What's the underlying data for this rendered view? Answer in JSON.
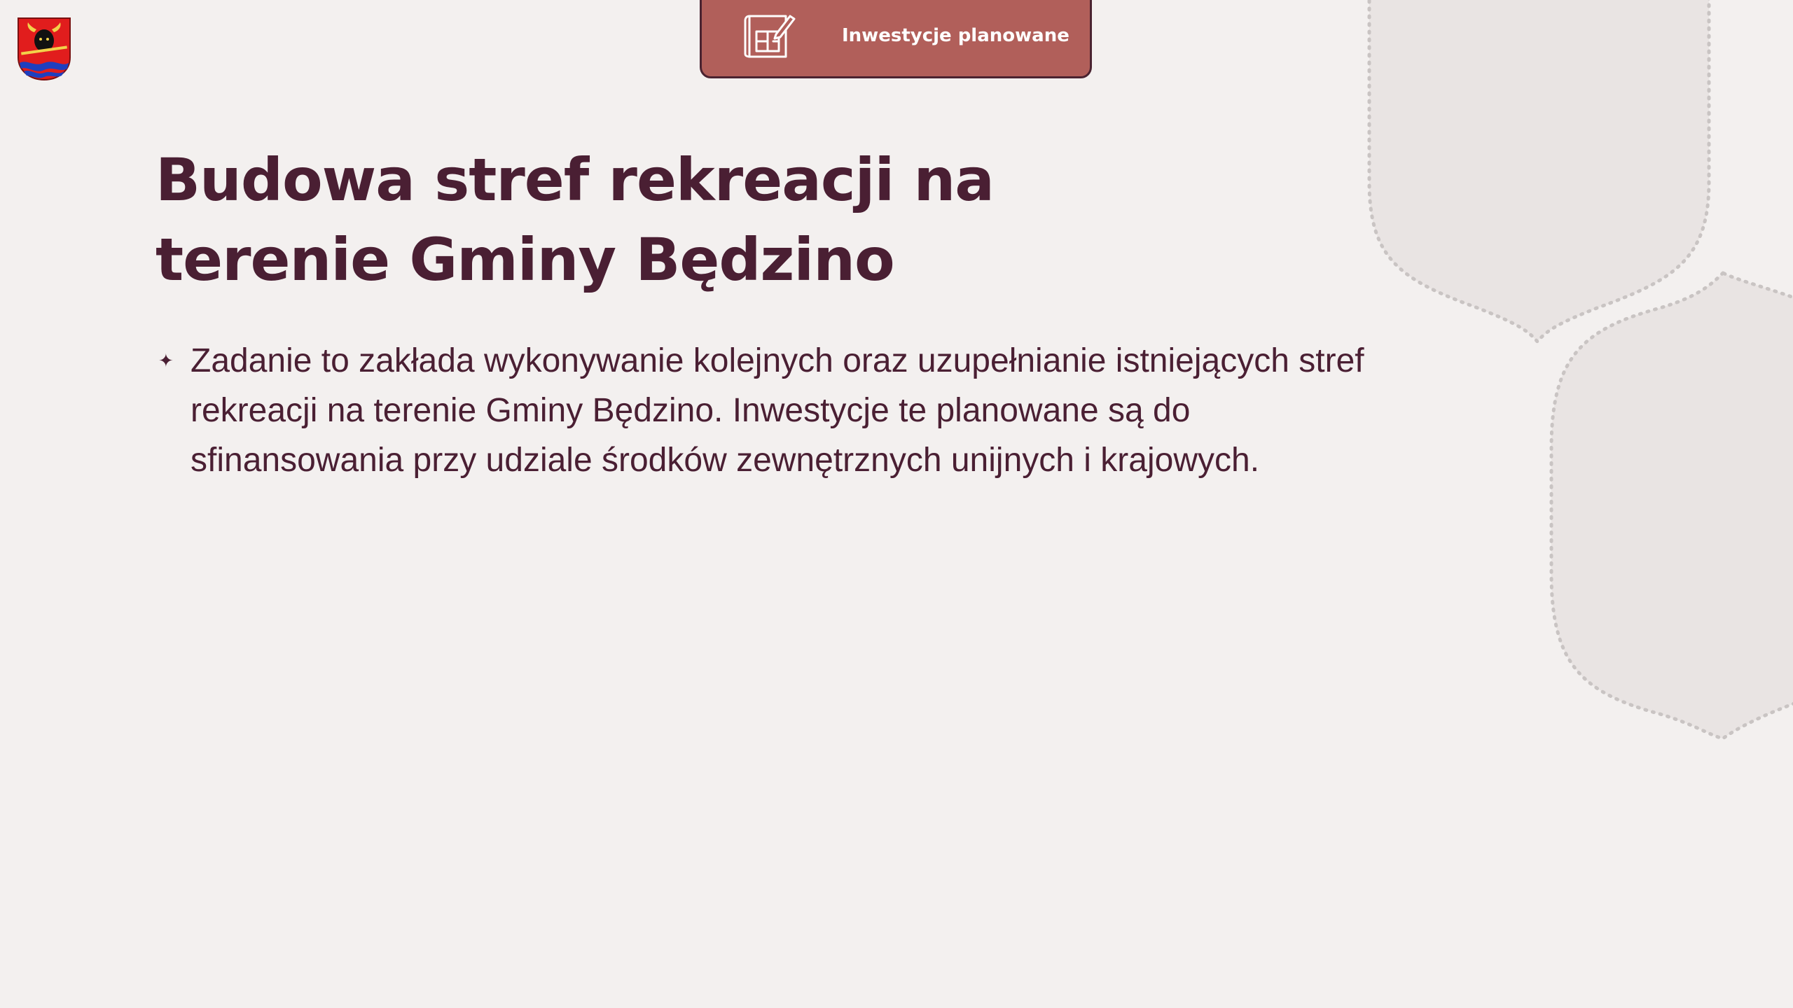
{
  "header_tab": {
    "label": "Inwestycje planowane",
    "icon": "blueprint-icon"
  },
  "logo": {
    "icon": "municipal-coat-of-arms"
  },
  "title": {
    "line1": "Budowa stref rekreacji na",
    "line2": "terenie Gminy Będzino"
  },
  "bullets": [
    {
      "marker": "✦",
      "lines": [
        "Zadanie to zakłada wykonywanie kolejnych oraz uzupełnianie istniejących stref",
        "rekreacji na terenie Gminy Będzino. Inwestycje te planowane są do",
        "sfinansowania przy udziale środków zewnętrznych unijnych i krajowych."
      ]
    }
  ],
  "colors": {
    "background": "#f3f0ef",
    "tab_fill": "#b15f5a",
    "tab_border": "#4a2330",
    "text_dark": "#4a1f33",
    "deco_fill": "#e9e4e3",
    "deco_dots": "#c9c4c3"
  }
}
